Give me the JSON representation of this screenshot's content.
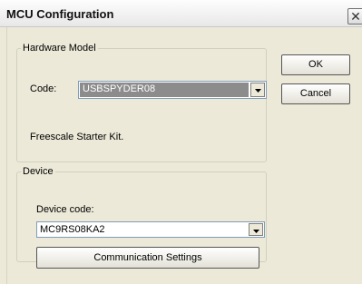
{
  "window": {
    "title": "MCU Configuration",
    "close_glyph": "✕"
  },
  "hardware_model": {
    "legend": "Hardware Model",
    "code_label": "Code:",
    "code_value": "USBSPYDER08",
    "description": "Freescale Starter Kit."
  },
  "device": {
    "legend": "Device",
    "device_code_label": "Device code:",
    "device_code_value": "MC9RS08KA2",
    "comm_settings_label": "Communication Settings"
  },
  "buttons": {
    "ok_label": "OK",
    "cancel_label": "Cancel"
  }
}
